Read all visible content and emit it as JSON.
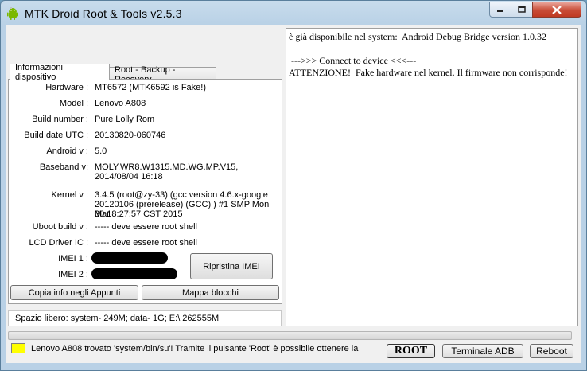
{
  "window": {
    "title": "MTK Droid Root & Tools v2.5.3"
  },
  "tabs": [
    {
      "label": "Informazioni dispositivo",
      "active": true
    },
    {
      "label": "Root - Backup - Recovery",
      "active": false
    }
  ],
  "device_info": {
    "hardware_label": "Hardware :",
    "hardware": "MT6572 (MTK6592 is Fake!)",
    "model_label": "Model :",
    "model": "Lenovo A808",
    "build_number_label": "Build number :",
    "build_number": "Pure Lolly Rom",
    "build_date_label": "Build date UTC :",
    "build_date": "20130820-060746",
    "android_label": "Android  v :",
    "android": "5.0",
    "baseband_label": "Baseband v:",
    "baseband_line1": "MOLY.WR8.W1315.MD.WG.MP.V15,",
    "baseband_line2": "2014/08/04 16:18",
    "kernel_label": "Kernel v :",
    "kernel_line1": "3.4.5 (root@zy-33) (gcc version 4.6.x-google",
    "kernel_line2": "20120106 (prerelease) (GCC) ) #1 SMP  Mon Mar",
    "kernel_line3": "30 18:27:57 CST 2015",
    "uboot_label": "Uboot build v :",
    "uboot": "----- deve essere  root shell",
    "lcd_label": "LCD Driver IC :",
    "lcd": "----- deve essere  root shell",
    "imei1_label": "IMEI 1 :",
    "imei2_label": "IMEI 2 :"
  },
  "buttons": {
    "restore_imei": "Ripristina IMEI",
    "copy_info": "Copia info negli Appunti",
    "block_map": "Mappa blocchi",
    "root": "ROOT",
    "adb_terminal": "Terminale ADB",
    "reboot": "Reboot"
  },
  "free_space": "Spazio libero: system- 249M; data- 1G;  E:\\ 262555M",
  "log_text": "è già disponibile nel system:  Android Debug Bridge version 1.0.32\n\n --->>> Connect to device <<<---\nATTENZIONE!  Fake hardware nel kernel. Il firmware non corrisponde!",
  "status": {
    "text": "Lenovo A808 trovato 'system/bin/su'! Tramite il pulsante 'Root' è possibile ottenere la",
    "indicator_color": "#ffff00"
  },
  "icons": {
    "app": "android-icon",
    "minimize": "minimize-icon",
    "maximize": "maximize-icon",
    "close": "close-icon"
  }
}
